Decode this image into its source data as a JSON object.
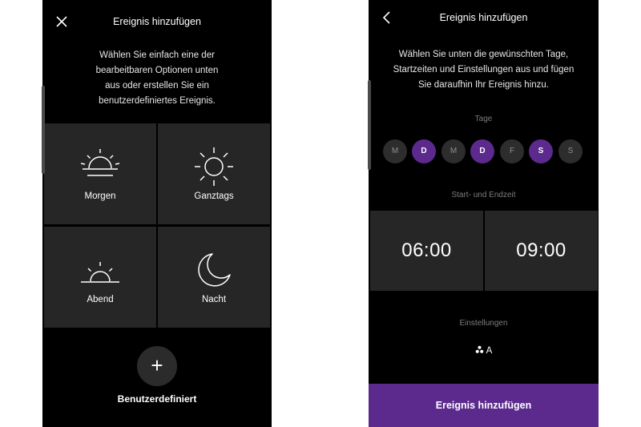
{
  "left_screen": {
    "title": "Ereignis hinzufügen",
    "close_icon": "close-icon",
    "intro_lines": [
      "Wählen Sie einfach eine der",
      "bearbeitbaren Optionen unten",
      "aus oder erstellen Sie ein",
      "benutzerdefiniertes Ereignis."
    ],
    "tiles": [
      {
        "label": "Morgen",
        "icon": "sunrise-icon"
      },
      {
        "label": "Ganztags",
        "icon": "sun-icon"
      },
      {
        "label": "Abend",
        "icon": "sunset-icon"
      },
      {
        "label": "Nacht",
        "icon": "moon-icon"
      }
    ],
    "add_symbol": "+",
    "custom_label": "Benutzerdefiniert"
  },
  "right_screen": {
    "title": "Ereignis hinzufügen",
    "back_icon": "back-chevron-icon",
    "intro_lines": [
      "Wählen Sie unten die gewünschten Tage,",
      "Startzeiten und Einstellungen aus und fügen",
      "Sie daraufhin Ihr Ereignis hinzu."
    ],
    "days_label": "Tage",
    "days": [
      {
        "label": "M",
        "selected": false
      },
      {
        "label": "D",
        "selected": true
      },
      {
        "label": "M",
        "selected": false
      },
      {
        "label": "D",
        "selected": true
      },
      {
        "label": "F",
        "selected": false
      },
      {
        "label": "S",
        "selected": true
      },
      {
        "label": "S",
        "selected": false
      }
    ],
    "time_label": "Start- und Endzeit",
    "start_time": "06:00",
    "end_time": "09:00",
    "settings_label": "Einstellungen",
    "settings_value": "A",
    "submit_label": "Ereignis hinzufügen"
  },
  "colors": {
    "background": "#000000",
    "tile": "#262626",
    "accent_purple": "#5b2a8c",
    "day_inactive": "#2d2d2d"
  }
}
